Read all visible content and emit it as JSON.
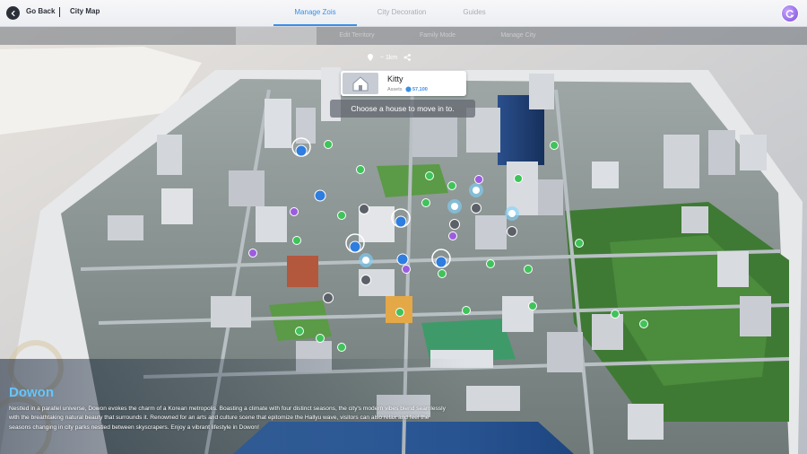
{
  "topbar": {
    "back_label": "Go Back",
    "breadcrumb": "City Map",
    "tabs": [
      {
        "label": "Manage Zois",
        "active": true
      },
      {
        "label": "City Decoration",
        "active": false
      },
      {
        "label": "Guides",
        "active": false
      }
    ],
    "avatar_icon": "profile-avatar-icon"
  },
  "subbar": {
    "tabs": [
      {
        "label": "",
        "active": true
      },
      {
        "label": "Edit Territory",
        "active": false
      },
      {
        "label": "Family Mode",
        "active": false
      },
      {
        "label": "Manage City",
        "active": false
      }
    ]
  },
  "house_card": {
    "name": "Kitty",
    "assets_label": "Assets",
    "assets_value": "57,100",
    "distance": "~ 1km",
    "prompt": "Choose a house to move in to."
  },
  "city": {
    "name": "Dowon",
    "description": "Nestled in a parallel universe, Dowon evokes the charm of a Korean metropolis. Boasting a climate with four distinct seasons, the city's modern vibes blend seamlessly with the breathtaking natural beauty that surrounds it. Renowned for an arts and culture scene that epitomize the Hallyu wave, visitors can also relax and feel the seasons changing in city parks nestled between skyscrapers. Enjoy a vibrant lifestyle in Dowon!"
  },
  "colors": {
    "accent": "#3a8fe6",
    "title": "#64c6ff",
    "park_marker": "#3fc35a",
    "house_marker": "#2e7de0",
    "poi_marker": "#9c5ce0"
  }
}
